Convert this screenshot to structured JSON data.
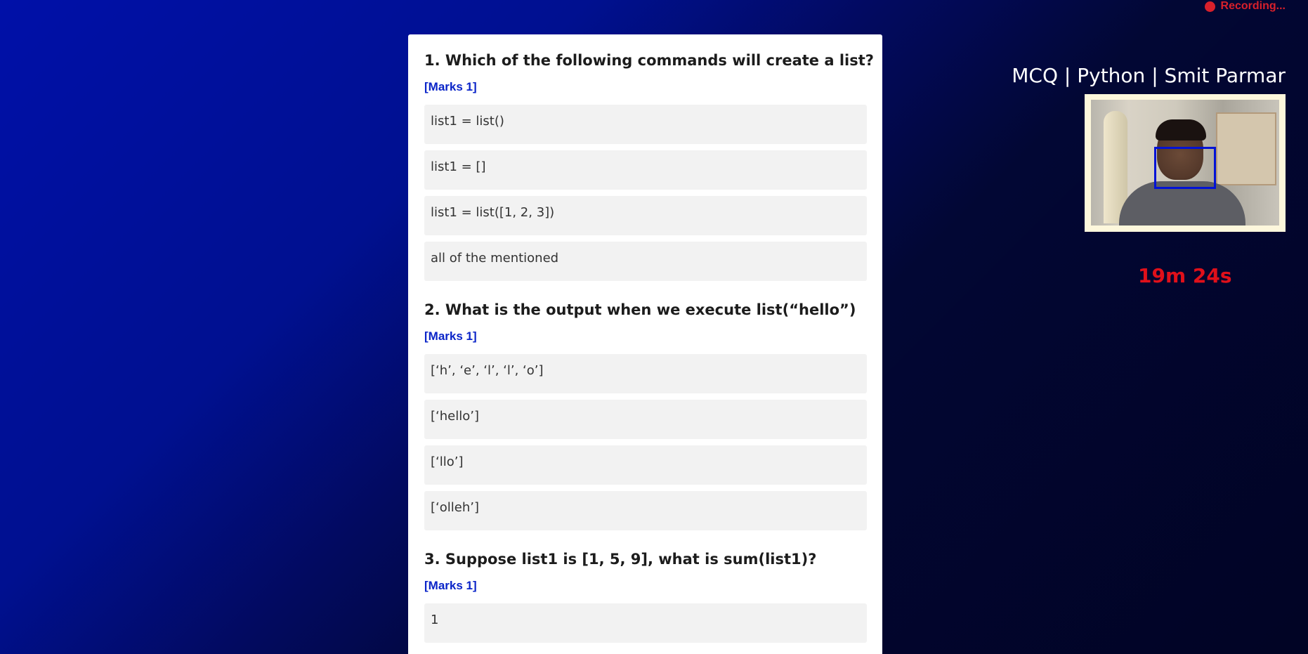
{
  "recording": {
    "label": "Recording..."
  },
  "header": {
    "title": "MCQ | Python | Smit Parmar"
  },
  "timer": {
    "remaining": "19m 24s"
  },
  "colors": {
    "timer": "#e0101a",
    "recording": "#d8202b",
    "marks": "#0a24c8",
    "face_box": "#0012d6",
    "panel": "#ffffff",
    "option_bg": "#f2f2f2"
  },
  "questions": [
    {
      "text": "1. Which of the following commands will create a list?",
      "marks": "[Marks 1]",
      "options": [
        "list1 = list()",
        "list1 = []",
        "list1 = list([1, 2, 3])",
        "all of the mentioned"
      ]
    },
    {
      "text": "2. What is the output when we execute list(“hello”)",
      "marks": "[Marks 1]",
      "options": [
        "[‘h’, ‘e’, ‘l’, ‘l’, ‘o’]",
        "[‘hello’]",
        "[‘llo’]",
        "[‘olleh’]"
      ]
    },
    {
      "text": "3. Suppose list1 is [1, 5, 9], what is sum(list1)?",
      "marks": "[Marks 1]",
      "options": [
        "1"
      ]
    }
  ]
}
